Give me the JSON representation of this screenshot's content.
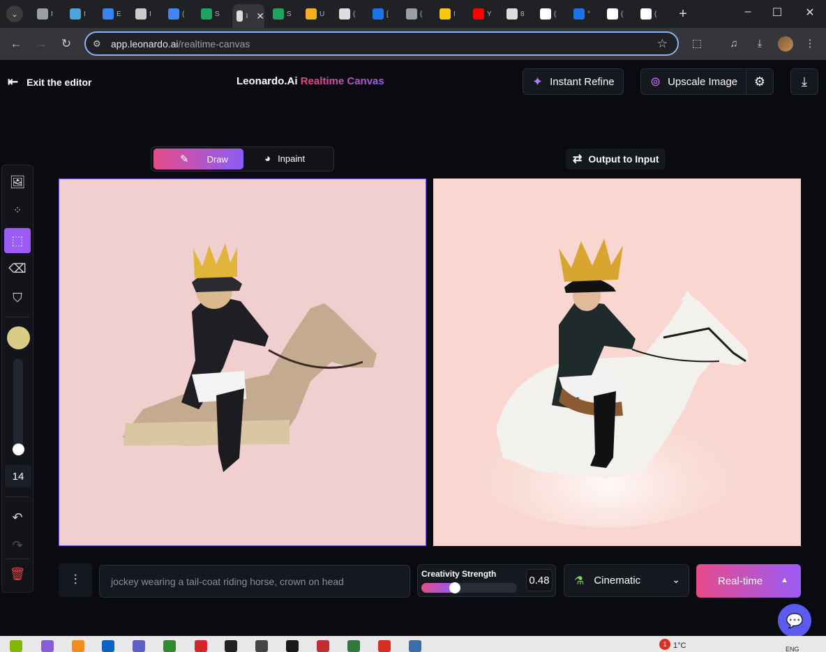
{
  "browser": {
    "url_host": "app.leonardo.ai",
    "url_path": "/realtime-canvas",
    "tabs": [
      {
        "icon": "circle-icon",
        "color": "#9aa0a6"
      },
      {
        "icon": "gear-icon",
        "color": "#4fa3d9"
      },
      {
        "icon": "puzzle-icon",
        "color": "#3b82f6"
      },
      {
        "icon": "openai-icon",
        "color": "#cccccc"
      },
      {
        "icon": "translate-icon",
        "color": "#4285f4"
      },
      {
        "icon": "sheet-icon",
        "color": "#1fa463"
      },
      {
        "icon": "page-icon",
        "color": "#dddddd",
        "active": true
      },
      {
        "icon": "sheet-icon",
        "color": "#1fa463"
      },
      {
        "icon": "hat-icon",
        "color": "#f2b01e"
      },
      {
        "icon": "castle-icon",
        "color": "#dddddd"
      },
      {
        "icon": "diamond-icon",
        "color": "#1a73e8"
      },
      {
        "icon": "globe-icon",
        "color": "#9aa0a6"
      },
      {
        "icon": "smile-icon",
        "color": "#f9c80e"
      },
      {
        "icon": "youtube-icon",
        "color": "#ff0000"
      },
      {
        "icon": "speaker-icon",
        "color": "#dddddd"
      },
      {
        "icon": "google-icon",
        "color": "#ffffff"
      },
      {
        "icon": "diamond-icon",
        "color": "#1a73e8"
      },
      {
        "icon": "google-icon",
        "color": "#ffffff"
      },
      {
        "icon": "google-icon",
        "color": "#ffffff"
      }
    ],
    "tab_texts": [
      "I",
      "I",
      "E",
      "I",
      "(",
      "S",
      "I",
      "S",
      "U",
      "(",
      "[",
      "(",
      "I",
      "Y",
      "8",
      "(",
      "°",
      "(",
      "("
    ]
  },
  "header": {
    "exit_label": "Exit the editor",
    "brand_name": "Leonardo.Ai",
    "brand_accent": "Realtime Canvas",
    "instant_refine_label": "Instant Refine",
    "upscale_label": "Upscale Image"
  },
  "mode": {
    "draw_label": "Draw",
    "inpaint_label": "Inpaint"
  },
  "output_to_input_label": "Output to Input",
  "tools": {
    "brush_color": "#d9cc84",
    "brush_size": "14",
    "brush_size_level": 0.05
  },
  "bottom": {
    "prompt_placeholder": "jockey wearing a tail-coat riding horse, crown on head",
    "creativity_label": "Creativity Strength",
    "creativity_value": "0.48",
    "creativity_level": 0.48,
    "style_label": "Cinematic",
    "realtime_label": "Real-time"
  },
  "taskbar": {
    "notification_count": "1",
    "temperature": "1°C",
    "language": "ENG"
  },
  "colors": {
    "accent_pink": "#e64c8a",
    "accent_purple": "#8b5cf6",
    "canvas_input_bg": "#f1cfcf",
    "canvas_output_bg": "#f9d6cf"
  }
}
